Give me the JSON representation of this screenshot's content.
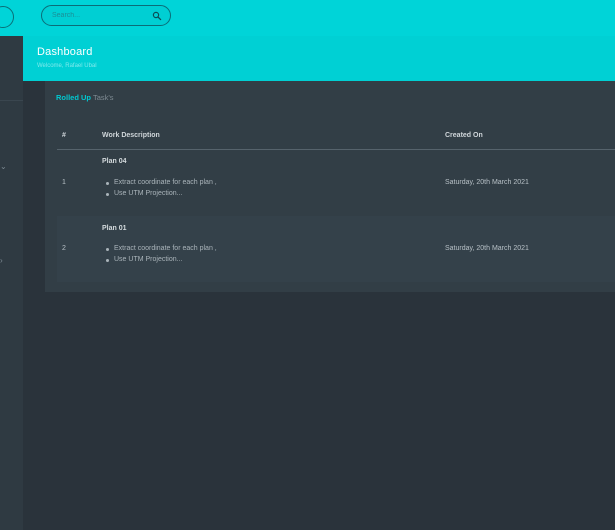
{
  "header": {
    "title": "Dashboard",
    "subtitle": "Welcome, Rafael Ubal"
  },
  "search": {
    "placeholder": "Search...",
    "value": ""
  },
  "card": {
    "title_accent": "Rolled Up",
    "title_rest": "Task's"
  },
  "table": {
    "columns": [
      "#",
      "Work Description",
      "Created On"
    ],
    "rows": [
      {
        "num": "1",
        "plan": "Plan 04",
        "tasks": [
          "Extract coordinate for each plan ,",
          "Use UTM Projection..."
        ],
        "created": "Saturday, 20th March 2021"
      },
      {
        "num": "2",
        "plan": "Plan 01",
        "tasks": [
          "Extract coordinate for each plan ,",
          "Use UTM Projection..."
        ],
        "created": "Saturday, 20th March 2021"
      }
    ]
  },
  "icons": {
    "search": "search-icon",
    "sidebar_chevrons": [
      "chevron-down-icon",
      "chevron-right-icon"
    ]
  },
  "colors": {
    "accent": "#00d4d8",
    "background": "#2a333b",
    "card": "#323e46"
  }
}
